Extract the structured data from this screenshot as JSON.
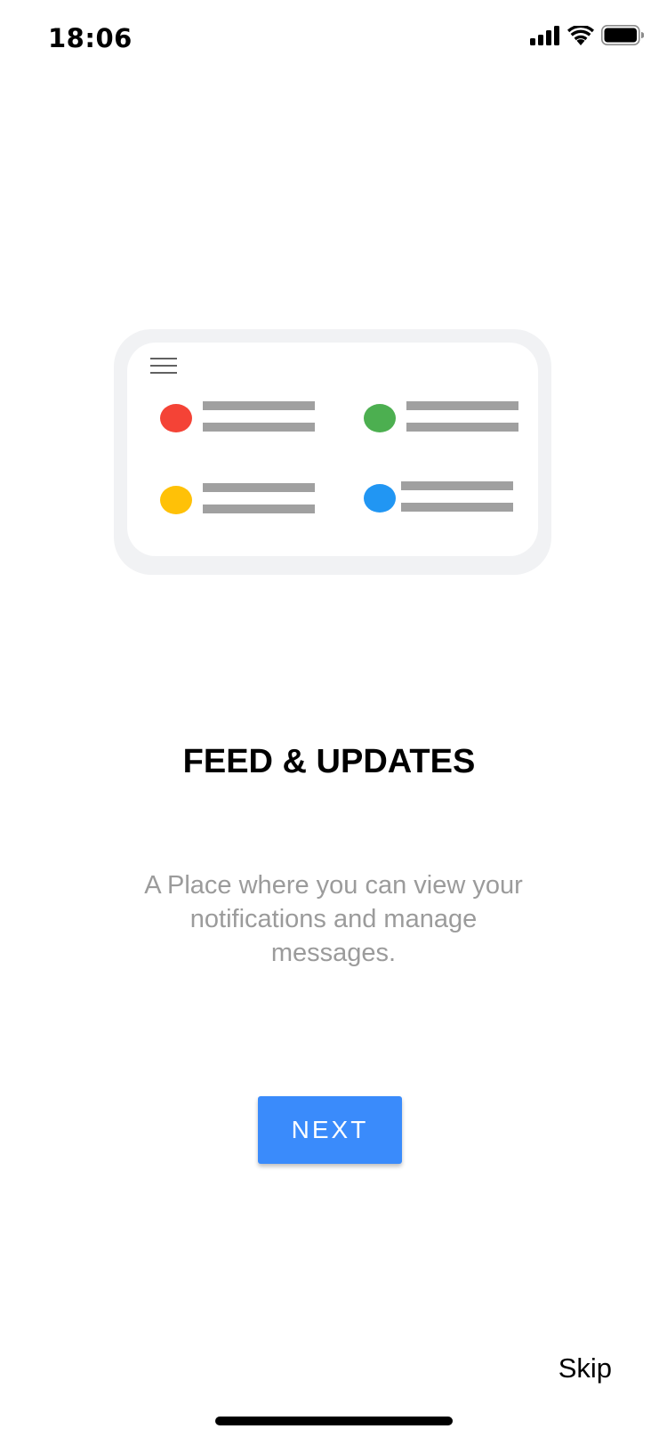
{
  "status_bar": {
    "time": "18:06",
    "icons": [
      "cellular-signal-icon",
      "wifi-icon",
      "battery-icon"
    ]
  },
  "illustration": {
    "menu_icon": "hamburger-menu-icon",
    "items": [
      {
        "dot_color": "#f44336"
      },
      {
        "dot_color": "#4caf50"
      },
      {
        "dot_color": "#ffc107"
      },
      {
        "dot_color": "#2196f3"
      }
    ]
  },
  "onboarding": {
    "title": "FEED & UPDATES",
    "description": "A Place where you can view your notifications and manage messages.",
    "next_label": "NEXT",
    "skip_label": "Skip"
  },
  "colors": {
    "accent": "#3a8bfb",
    "description_text": "#9b9b9b"
  }
}
